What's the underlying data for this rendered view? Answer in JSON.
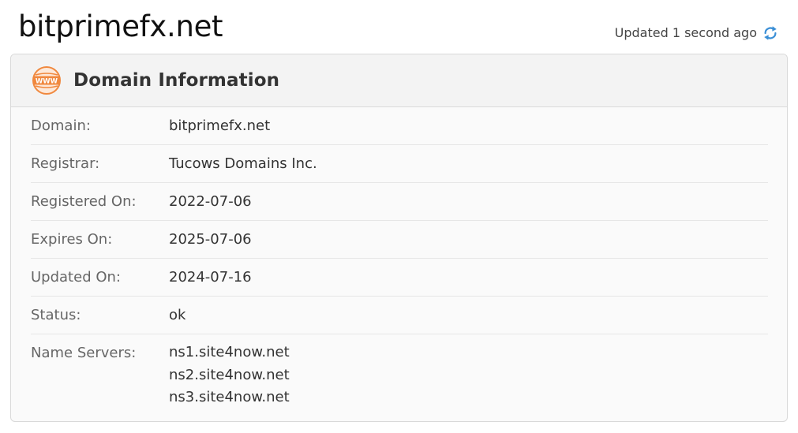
{
  "page": {
    "title": "bitprimefx.net",
    "updated_text": "Updated 1 second ago"
  },
  "card": {
    "title": "Domain Information",
    "icon_text": "WWW",
    "rows": [
      {
        "label": "Domain:",
        "value": "bitprimefx.net"
      },
      {
        "label": "Registrar:",
        "value": "Tucows Domains Inc."
      },
      {
        "label": "Registered On:",
        "value": "2022-07-06"
      },
      {
        "label": "Expires On:",
        "value": "2025-07-06"
      },
      {
        "label": "Updated On:",
        "value": "2024-07-16"
      },
      {
        "label": "Status:",
        "value": "ok"
      }
    ],
    "name_servers": {
      "label": "Name Servers:",
      "values": [
        "ns1.site4now.net",
        "ns2.site4now.net",
        "ns3.site4now.net"
      ]
    }
  },
  "icons": {
    "refresh": "refresh-icon",
    "www": "www-globe-icon"
  },
  "colors": {
    "accent_orange": "#f0883e",
    "refresh_blue": "#3b8fd6"
  }
}
